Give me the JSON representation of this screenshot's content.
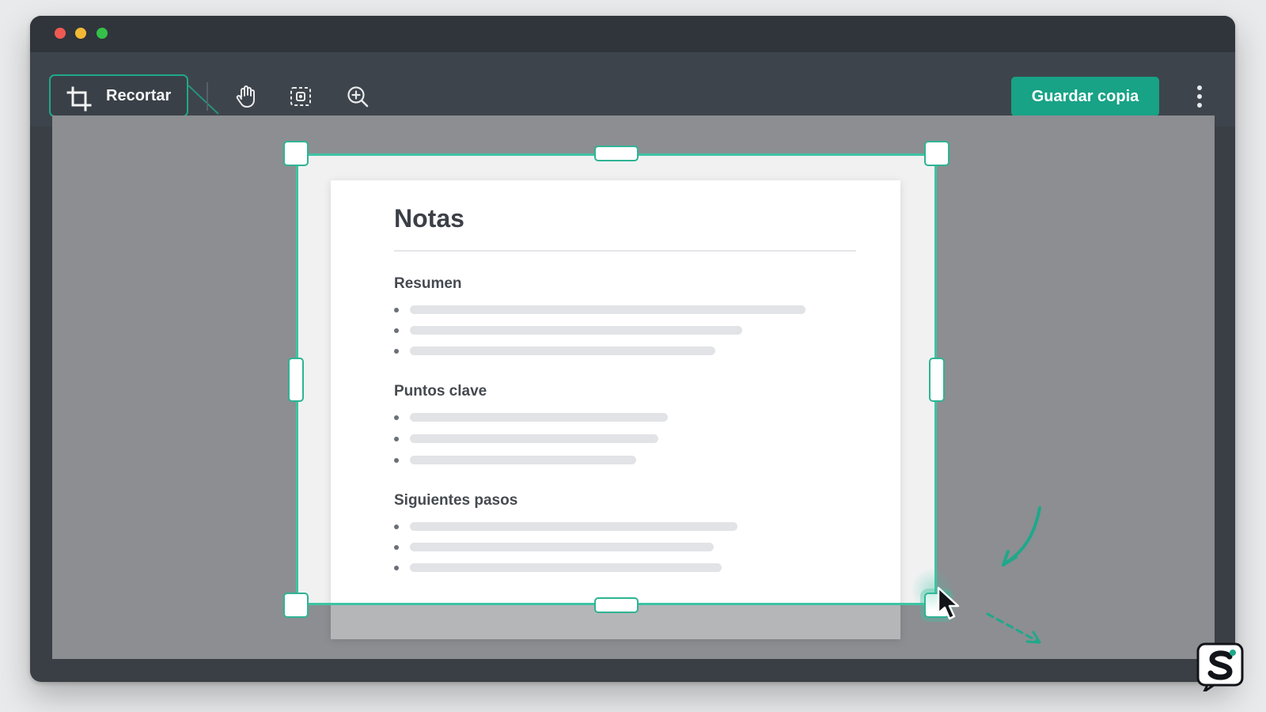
{
  "toolbar": {
    "crop_label": "Recortar",
    "save_label": "Guardar copia",
    "tools": [
      "pan-hand",
      "select-region",
      "zoom-in"
    ]
  },
  "document": {
    "title": "Notas",
    "sections": [
      {
        "title": "Resumen",
        "lines": 3
      },
      {
        "title": "Puntos clave",
        "lines": 3
      },
      {
        "title": "Siguientes pasos",
        "lines": 3
      }
    ]
  },
  "colors": {
    "accent": "#18a286",
    "crop_border": "#3cc4a3",
    "window_bg": "#3a3f45",
    "canvas_bg": "#8c8e92"
  },
  "icons": {
    "crop": "crop-icon",
    "hand": "hand-icon",
    "select": "select-region-icon",
    "zoom": "zoom-in-icon",
    "more": "more-vertical-icon",
    "cursor": "mouse-pointer-icon",
    "logo": "app-logo-icon"
  }
}
